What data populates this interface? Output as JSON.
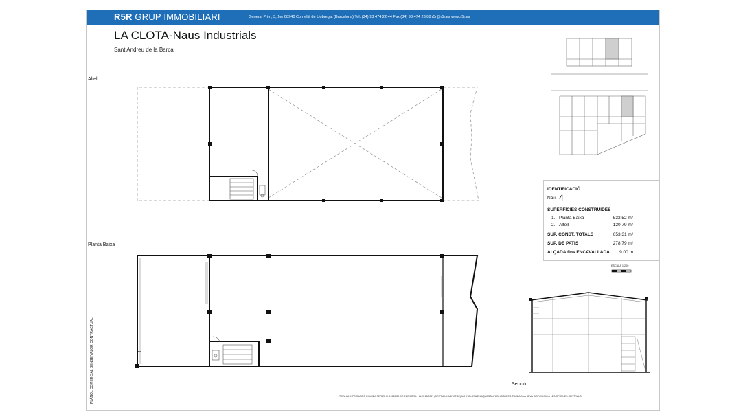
{
  "header": {
    "brand_bold": "R5R",
    "brand_rest": " GRUP IMMOBILIARI",
    "contact": "General Prim, 3, 1er  08940 Cornellà de Llobregat (Barcelona)  Tel. (34) 93 474 22 44  Fax (34) 93 474 23 88  r5r@r5r.es  www.r5r.es"
  },
  "title": "LA CLOTA-Naus Industrials",
  "subtitle": "Sant Andreu de la Barca",
  "plans": {
    "upper_label": "Altell",
    "ground_label": "Planta Baixa"
  },
  "info": {
    "identificacio_label": "IDENTIFICACIÓ",
    "nau_label": "Nau",
    "nau_number": "4",
    "superficies_label": "SUPERFÍCIES CONSTRUIDES",
    "areas": [
      {
        "num": "1.",
        "name": "Planta Baixa",
        "value": "532.52 m²"
      },
      {
        "num": "2.",
        "name": "Altell",
        "value": "120.79 m²"
      }
    ],
    "totals": [
      {
        "label": "SUP. CONST. TOTALS",
        "value": "653.31 m²"
      },
      {
        "label": "SUP. DE PATIS",
        "value": "278.79 m²"
      },
      {
        "label": "ALÇADA fins ENCAVALLADA",
        "value": "9.00 m"
      }
    ]
  },
  "scale_label": "ESCALA 1/200",
  "section_label": "Secció",
  "vertical_note": "PLÀNOL COMERCIAL SENSE VALOR CONTRACTUAL",
  "footer_note": "TOTA LA INFORMACIÓ EXIGIDA PER EL R.D. 515/89 DE 21 D'ABRIL I LLEI 18/2007 (DRET A L'HABITATGE) NO INCLOSA EN AQUESTA PUBLICITAT ES TROBA A LA SEVA DISPOSICIÓ A LES OFICINES CENTRALS"
}
